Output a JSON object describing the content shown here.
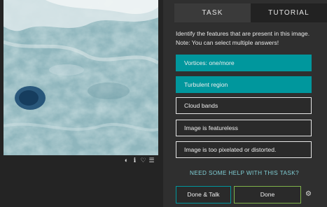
{
  "tabs": {
    "task": "TASK",
    "tutorial": "TUTORIAL"
  },
  "question": "Identify the features that are present in this image. Note: You can select multiple answers!",
  "answers": [
    {
      "label": "Vortices: one/more",
      "selected": true
    },
    {
      "label": "Turbulent region",
      "selected": true
    },
    {
      "label": "Cloud bands",
      "selected": false
    },
    {
      "label": "Image is featureless",
      "selected": false
    },
    {
      "label": "Image is too pixelated or distorted.",
      "selected": false
    }
  ],
  "help_link": "NEED SOME HELP WITH THIS TASK?",
  "buttons": {
    "done_talk": "Done & Talk",
    "done": "Done"
  },
  "icons": {
    "invert": "contrast-icon",
    "info": "info-icon",
    "favorite": "heart-icon",
    "collect": "collection-icon",
    "settings": "gear-icon"
  },
  "colors": {
    "accent": "#00979d",
    "done_border": "#7fb34a",
    "help_text": "#80cfd6"
  }
}
